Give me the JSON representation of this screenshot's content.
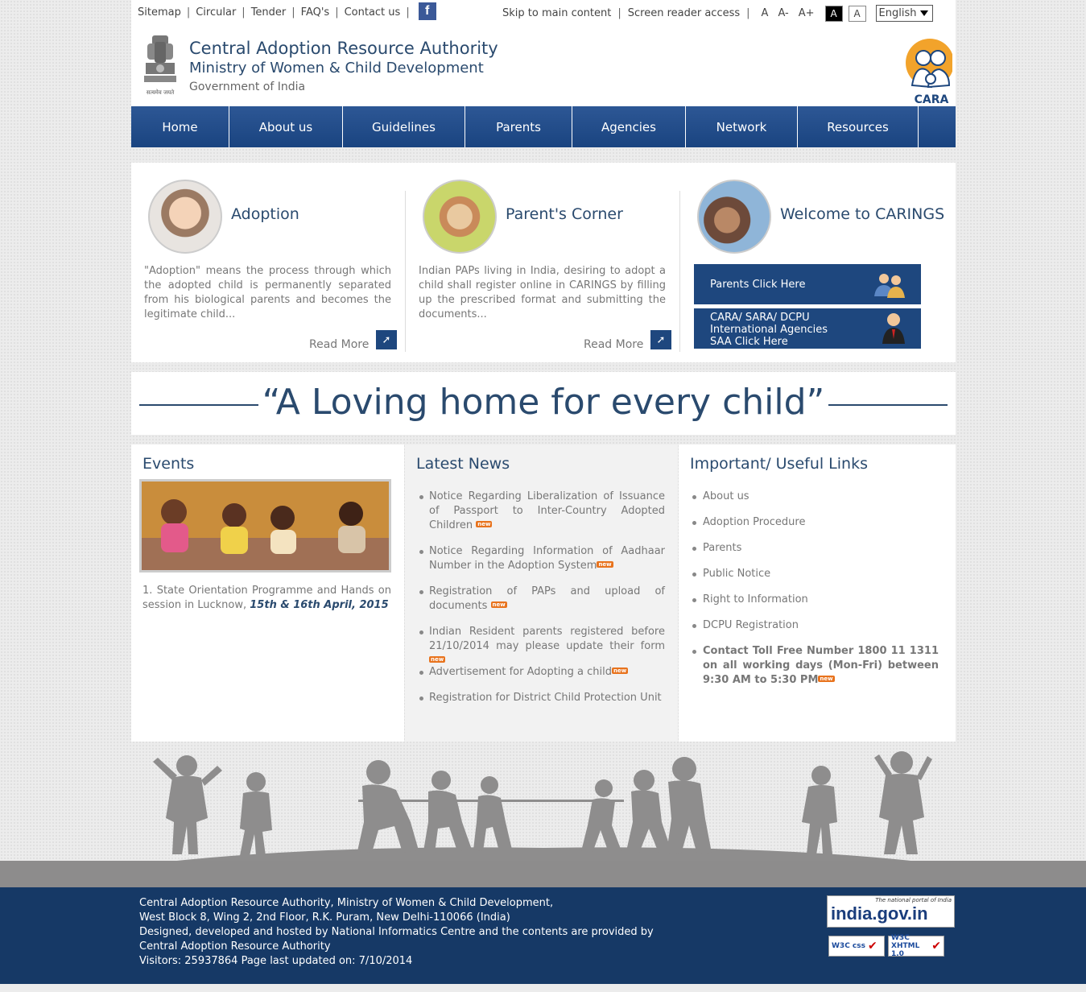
{
  "topbar": {
    "left_links": [
      "Sitemap",
      "Circular",
      "Tender",
      "FAQ's",
      "Contact us"
    ],
    "skip_link": "Skip to main content",
    "screen_reader": "Screen reader access",
    "font_small": "A",
    "font_minus": "A-",
    "font_plus": "A+",
    "contrast_dark": "A",
    "contrast_light": "A",
    "language": "English",
    "facebook_icon": "f"
  },
  "header": {
    "org_name": "Central Adoption Resource Authority",
    "ministry": "Ministry of Women & Child Development",
    "government": "Government of India",
    "emblem_caption": "सत्यमेव जयते",
    "logo_text": "CARA"
  },
  "nav": {
    "items": [
      "Home",
      "About us",
      "Guidelines",
      "Parents",
      "Agencies",
      "Network",
      "Resources"
    ]
  },
  "cards": {
    "adoption": {
      "title": "Adoption",
      "text": "\"Adoption\" means the process through which the adopted child is permanently separated from his biological parents and becomes the legitimate child...",
      "read_more": "Read More"
    },
    "parents_corner": {
      "title": "Parent's Corner",
      "text": "Indian PAPs living in India, desiring to adopt a child shall register online in CARINGS by filling up the prescribed format and submitting the documents...",
      "read_more": "Read More"
    },
    "carings": {
      "title": "Welcome to CARINGS",
      "parents_button": "Parents Click Here",
      "agency_line1": "CARA/ SARA/ DCPU",
      "agency_line2": "International Agencies",
      "agency_line3": "SAA Click Here"
    }
  },
  "tagline": "“A Loving home for every child”",
  "events": {
    "title": "Events",
    "item_number": "1.",
    "item_text": "State Orientation Programme and Hands on session in Lucknow,",
    "item_date": "15th  &  16th April, 2015"
  },
  "news": {
    "title": "Latest News",
    "new_label": "new",
    "items": [
      "Notice Regarding Liberalization of Issuance of Passport to Inter-Country Adopted Children",
      "Notice Regarding Information of Aadhaar Number in the Adoption System",
      "Registration of PAPs and upload of documents",
      "Indian Resident parents registered before 21/10/2014 may please update their form",
      "Advertisement for Adopting a child",
      "Registration for District Child Protection Unit"
    ]
  },
  "links": {
    "title": "Important/ Useful Links",
    "items": [
      "About us",
      "Adoption Procedure",
      "Parents",
      "Public Notice",
      "Right to Information",
      "DCPU Registration"
    ],
    "contact": "Contact Toll Free Number 1800 11 1311 on all working days (Mon-Fri) between 9:30 AM to 5:30 PM"
  },
  "footer": {
    "line1": "Central Adoption Resource Authority, Ministry of Women & Child Development,",
    "line2": "West Block 8, Wing 2, 2nd Floor, R.K. Puram, New Delhi-110066 (India)",
    "line3": "Designed, developed and hosted by National Informatics Centre and the contents are provided by",
    "line4": "Central Adoption Resource Authority",
    "visitors": "Visitors: 25937864   Page last updated on: 7/10/2014",
    "india_gov_tagline": "The national portal of India",
    "india_gov": "india.gov.in",
    "w3c_css": "W3C css",
    "w3c_xhtml": "W3C XHTML 1.0"
  },
  "colors": {
    "navy": "#1e477e",
    "title_blue": "#2a4a6e",
    "footer": "#163966",
    "new_badge": "#e8731d"
  }
}
